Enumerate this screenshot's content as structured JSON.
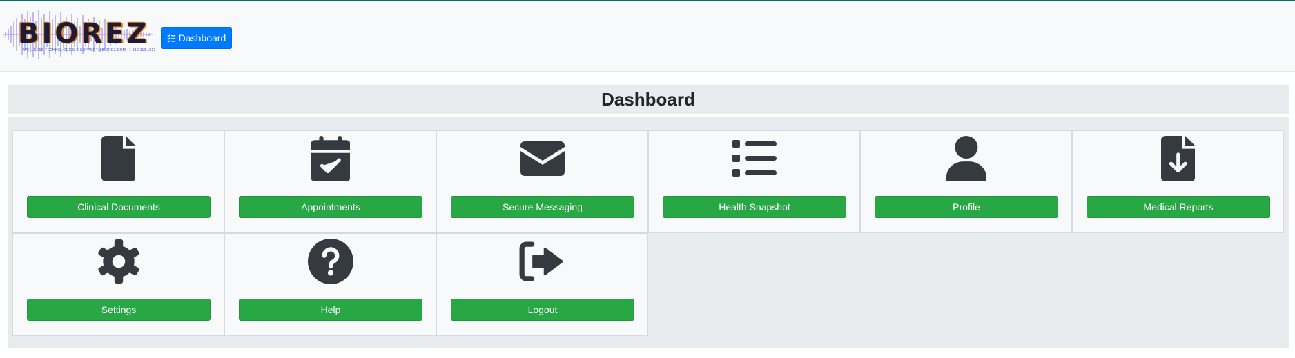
{
  "header": {
    "logo_text": "BIOREZ",
    "logo_subtext": "WELLNESS TECHNOLOGIES  ©  SUPPORT@BIOREZ.COM  +1 310.112.1812",
    "dashboard_button_label": "Dashboard"
  },
  "page": {
    "title": "Dashboard"
  },
  "tiles": [
    {
      "label": "Clinical Documents",
      "icon": "document-icon"
    },
    {
      "label": "Appointments",
      "icon": "calendar-check-icon"
    },
    {
      "label": "Secure Messaging",
      "icon": "envelope-icon"
    },
    {
      "label": "Health Snapshot",
      "icon": "list-icon"
    },
    {
      "label": "Profile",
      "icon": "user-icon"
    },
    {
      "label": "Medical Reports",
      "icon": "file-download-icon"
    },
    {
      "label": "Settings",
      "icon": "gear-icon"
    },
    {
      "label": "Help",
      "icon": "question-circle-icon"
    },
    {
      "label": "Logout",
      "icon": "sign-out-icon"
    }
  ],
  "colors": {
    "primary_blue": "#007bff",
    "success_green": "#28a745",
    "icon_dark": "#343a40",
    "top_border": "#0b6b60"
  }
}
